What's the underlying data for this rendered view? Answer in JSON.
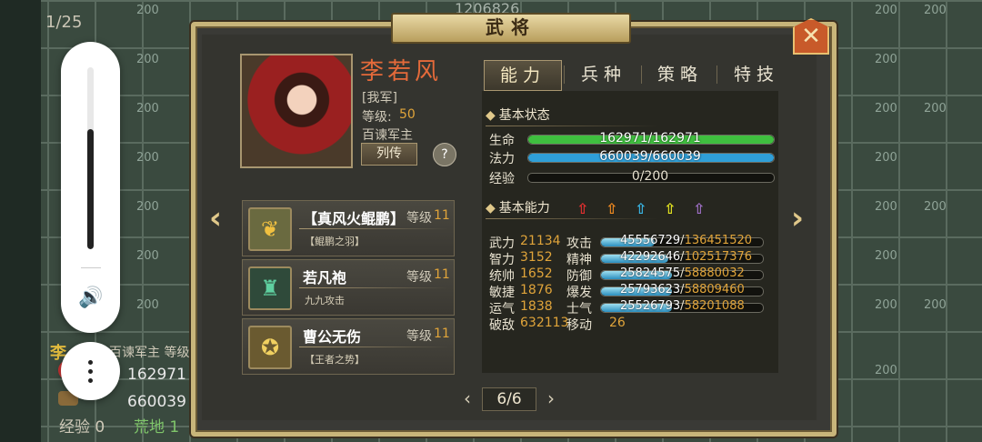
{
  "background": {
    "page_counter": "1/25",
    "top_resource": "1206826",
    "tile_label": "200",
    "unit_name": "李",
    "unit_role": "百谏军主  等级",
    "unit_hp": "162971",
    "unit_mp": "660039",
    "unit_exp_label": "经验",
    "unit_exp_value": "0",
    "unit_terrain": "荒地 1"
  },
  "volume_overlay": {
    "level": 0.66,
    "speaker_icon": "speaker-icon",
    "more_icon": "more-vertical-icon"
  },
  "dialog": {
    "title": "武将",
    "close_icon": "close-icon"
  },
  "hero": {
    "name": "李若风",
    "faction": "[我军]",
    "level_label": "等级:",
    "level_value": "50",
    "title": "百谏军主",
    "bio_button": "列传",
    "help_button": "?"
  },
  "equipment": [
    {
      "name": "【真风火鲲鹏】",
      "level_label": "等级",
      "level": "11",
      "sub": "【鲲鹏之羽】",
      "icon": "feather-icon"
    },
    {
      "name": "若凡袍",
      "level_label": "等级",
      "level": "11",
      "sub": "九九攻击",
      "icon": "armor-icon"
    },
    {
      "name": "曹公无伤",
      "level_label": "等级",
      "level": "11",
      "sub": "【王者之势】",
      "icon": "medallion-icon"
    }
  ],
  "tabs": [
    {
      "label": "能力",
      "active": true
    },
    {
      "label": "兵种",
      "active": false
    },
    {
      "label": "策略",
      "active": false
    },
    {
      "label": "特技",
      "active": false
    }
  ],
  "basic_status": {
    "header": "基本状态",
    "hp": {
      "label": "生命",
      "text": "162971/162971",
      "fraction": 1.0,
      "color": "#3fbf3f"
    },
    "mp": {
      "label": "法力",
      "text": "660039/660039",
      "fraction": 1.0,
      "color": "#2f9fd8"
    },
    "exp": {
      "label": "经验",
      "text": "0/200",
      "fraction": 0.0
    }
  },
  "basic_ability": {
    "header": "基本能力",
    "arrow_colors": [
      "#e53030",
      "#f08a20",
      "#39b8e8",
      "#e8e820",
      "#a070c8"
    ]
  },
  "attributes": [
    {
      "name": "武力",
      "value": "21134",
      "stat": "攻击",
      "current": "45556729",
      "max": "136451520",
      "fraction": 0.334
    },
    {
      "name": "智力",
      "value": "3152",
      "stat": "精神",
      "current": "42292646",
      "max": "102517376",
      "fraction": 0.413
    },
    {
      "name": "统帅",
      "value": "1652",
      "stat": "防御",
      "current": "25824575",
      "max": "58880032",
      "fraction": 0.439
    },
    {
      "name": "敏捷",
      "value": "1876",
      "stat": "爆发",
      "current": "25793623",
      "max": "58809460",
      "fraction": 0.439
    },
    {
      "name": "运气",
      "value": "1838",
      "stat": "士气",
      "current": "25526793",
      "max": "58201088",
      "fraction": 0.439
    }
  ],
  "extra": {
    "kills_label": "破敌",
    "kills_value": "632113",
    "move_label": "移动",
    "move_value": "26"
  },
  "pager": {
    "text": "6/6",
    "prev": "‹",
    "next": "›"
  },
  "nav": {
    "left": "‹",
    "right": "›"
  }
}
